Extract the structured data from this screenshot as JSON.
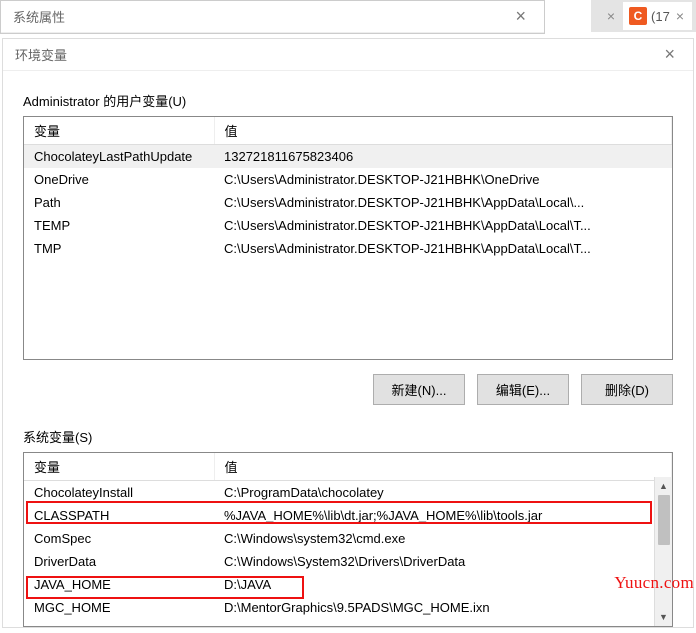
{
  "bg_tabs": {
    "tab1_close": "×",
    "tab2_icon": "C",
    "tab2_label": "(17",
    "tab2_close": "×"
  },
  "dlg1": {
    "title": "系统属性",
    "close": "×"
  },
  "dlg2": {
    "title": "环境变量",
    "close": "×"
  },
  "user_vars": {
    "label": "Administrator 的用户变量(U)",
    "col_var": "变量",
    "col_val": "值",
    "rows": [
      {
        "name": "ChocolateyLastPathUpdate",
        "value": "132721811675823406"
      },
      {
        "name": "OneDrive",
        "value": "C:\\Users\\Administrator.DESKTOP-J21HBHK\\OneDrive"
      },
      {
        "name": "Path",
        "value": "C:\\Users\\Administrator.DESKTOP-J21HBHK\\AppData\\Local\\..."
      },
      {
        "name": "TEMP",
        "value": "C:\\Users\\Administrator.DESKTOP-J21HBHK\\AppData\\Local\\T..."
      },
      {
        "name": "TMP",
        "value": "C:\\Users\\Administrator.DESKTOP-J21HBHK\\AppData\\Local\\T..."
      }
    ],
    "btn_new": "新建(N)...",
    "btn_edit": "编辑(E)...",
    "btn_del": "删除(D)"
  },
  "sys_vars": {
    "label": "系统变量(S)",
    "col_var": "变量",
    "col_val": "值",
    "rows": [
      {
        "name": "ChocolateyInstall",
        "value": "C:\\ProgramData\\chocolatey"
      },
      {
        "name": "CLASSPATH",
        "value": "%JAVA_HOME%\\lib\\dt.jar;%JAVA_HOME%\\lib\\tools.jar"
      },
      {
        "name": "ComSpec",
        "value": "C:\\Windows\\system32\\cmd.exe"
      },
      {
        "name": "DriverData",
        "value": "C:\\Windows\\System32\\Drivers\\DriverData"
      },
      {
        "name": "JAVA_HOME",
        "value": "D:\\JAVA"
      },
      {
        "name": "MGC_HOME",
        "value": "D:\\MentorGraphics\\9.5PADS\\MGC_HOME.ixn"
      }
    ]
  },
  "watermark": "Yuucn.com",
  "scroll": {
    "up": "▲",
    "down": "▼"
  }
}
